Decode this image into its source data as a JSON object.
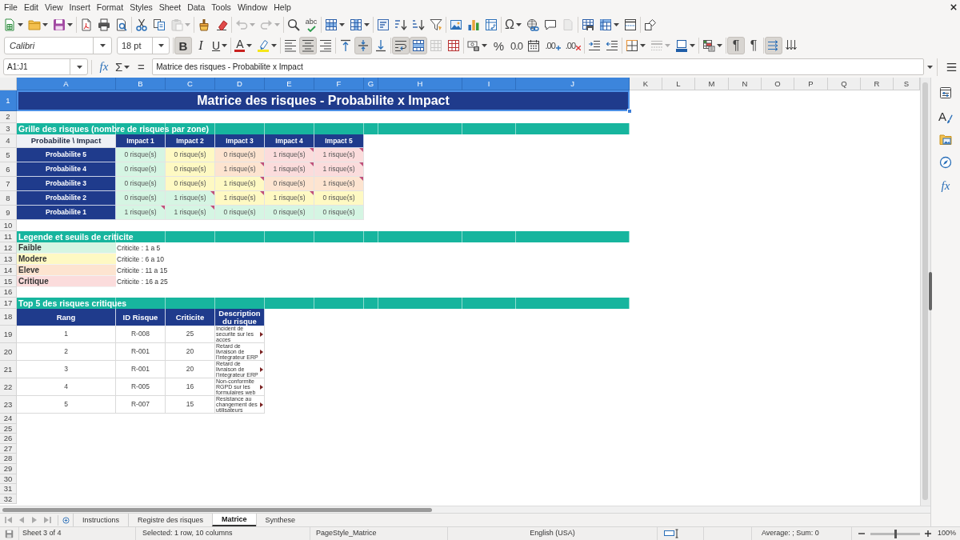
{
  "menu_bar": [
    "File",
    "Edit",
    "View",
    "Insert",
    "Format",
    "Styles",
    "Sheet",
    "Data",
    "Tools",
    "Window",
    "Help"
  ],
  "standard_toolbar": [
    [
      {
        "kind": "new",
        "disabled": false
      },
      {
        "kind": "open",
        "disabled": false
      },
      {
        "kind": "save",
        "disabled": false
      }
    ],
    [
      {
        "kind": "export_pdf",
        "disabled": false
      },
      {
        "kind": "print",
        "disabled": false
      },
      {
        "kind": "print_preview",
        "disabled": false
      }
    ],
    [
      {
        "kind": "cut",
        "disabled": false
      },
      {
        "kind": "copy",
        "disabled": false
      },
      {
        "kind": "paste",
        "disabled": true
      }
    ],
    [
      {
        "kind": "clone_formatting",
        "disabled": false
      },
      {
        "kind": "clear_formatting",
        "disabled": false
      }
    ],
    [
      {
        "kind": "undo",
        "disabled": true
      },
      {
        "kind": "redo",
        "disabled": true
      }
    ],
    [
      {
        "kind": "find_replace",
        "disabled": false
      },
      {
        "kind": "spelling",
        "glyph": "abc",
        "disabled": false
      }
    ],
    [
      {
        "kind": "row",
        "disabled": false
      },
      {
        "kind": "column",
        "disabled": false
      }
    ],
    [
      {
        "kind": "sort",
        "disabled": false
      },
      {
        "kind": "sort_ascending",
        "disabled": false
      },
      {
        "kind": "sort_descending",
        "disabled": false
      },
      {
        "kind": "autofilter",
        "disabled": false
      }
    ],
    [
      {
        "kind": "image",
        "disabled": false
      },
      {
        "kind": "chart",
        "disabled": false
      },
      {
        "kind": "pivot_table",
        "disabled": false
      }
    ],
    [
      {
        "kind": "special_character",
        "glyph": "Ω",
        "disabled": false
      },
      {
        "kind": "hyperlink",
        "disabled": false
      },
      {
        "kind": "comment",
        "disabled": false
      },
      {
        "kind": "header_footer",
        "disabled": true
      }
    ],
    [
      {
        "kind": "print_area",
        "disabled": false
      },
      {
        "kind": "freeze",
        "disabled": false
      },
      {
        "kind": "split_window",
        "disabled": false
      }
    ],
    [
      {
        "kind": "draw_functions",
        "disabled": false
      }
    ]
  ],
  "formatting_toolbar": {
    "font_name": "Calibri",
    "font_size": "18 pt",
    "groups": [
      [
        {
          "kind": "bold",
          "glyph": "B",
          "on": true,
          "disabled": false
        },
        {
          "kind": "italic",
          "glyph": "I",
          "on": false,
          "disabled": false
        },
        {
          "kind": "underline",
          "glyph": "U",
          "on": false,
          "disabled": false
        }
      ],
      [
        {
          "kind": "font_color",
          "glyph": "A",
          "on": false,
          "disabled": false
        },
        {
          "kind": "highlight",
          "on": false,
          "disabled": false
        }
      ],
      [
        {
          "kind": "align_left",
          "on": false,
          "disabled": false
        },
        {
          "kind": "align_center",
          "on": true,
          "disabled": false
        },
        {
          "kind": "align_right",
          "on": false,
          "disabled": false
        }
      ],
      [
        {
          "kind": "align_top",
          "on": false,
          "disabled": false
        },
        {
          "kind": "align_middle",
          "on": true,
          "disabled": false
        },
        {
          "kind": "align_bottom",
          "on": false,
          "disabled": false
        }
      ],
      [
        {
          "kind": "wrap_text",
          "on": true,
          "disabled": false
        },
        {
          "kind": "merge_center",
          "on": true,
          "disabled": false
        },
        {
          "kind": "merge_cells",
          "on": false,
          "disabled": true
        },
        {
          "kind": "unmerge_cells",
          "on": false,
          "disabled": false
        }
      ],
      [
        {
          "kind": "currency",
          "on": false,
          "disabled": false
        },
        {
          "kind": "percent",
          "glyph": "%",
          "on": false,
          "disabled": false
        },
        {
          "kind": "number",
          "glyph": "0.0",
          "on": false,
          "disabled": false
        },
        {
          "kind": "date",
          "on": false,
          "disabled": false
        },
        {
          "kind": "add_decimal",
          "glyph": ".00",
          "on": false,
          "disabled": false
        },
        {
          "kind": "delete_decimal",
          "glyph": ".00",
          "on": false,
          "disabled": false
        }
      ],
      [
        {
          "kind": "increase_indent",
          "on": false,
          "disabled": false
        },
        {
          "kind": "decrease_indent",
          "on": false,
          "disabled": false
        }
      ],
      [
        {
          "kind": "borders",
          "on": false,
          "disabled": false
        },
        {
          "kind": "border_style",
          "on": false,
          "disabled": true
        },
        {
          "kind": "border_color",
          "on": false,
          "disabled": false
        }
      ],
      [
        {
          "kind": "conditional",
          "on": false,
          "disabled": false
        }
      ],
      [
        {
          "kind": "left_to_right",
          "glyph": "¶",
          "on": true,
          "disabled": false
        },
        {
          "kind": "right_to_left",
          "glyph": "¶",
          "on": false,
          "disabled": false
        }
      ],
      [
        {
          "kind": "text_horizontal",
          "on": true,
          "disabled": false
        },
        {
          "kind": "text_vertical",
          "on": false,
          "disabled": false
        }
      ]
    ]
  },
  "formula_bar": {
    "name_box": "A1:J1",
    "buttons": [
      {
        "kind": "function_wizard",
        "glyph": "fx"
      },
      {
        "kind": "sum",
        "glyph": "Σ"
      },
      {
        "kind": "formula",
        "glyph": "="
      }
    ],
    "content": "Matrice des risques - Probabilite x Impact"
  },
  "sidebar": [
    {
      "kind": "properties"
    },
    {
      "kind": "styles",
      "glyph": "A"
    },
    {
      "kind": "gallery"
    },
    {
      "kind": "navigator"
    },
    {
      "kind": "functions",
      "glyph": "fx"
    }
  ],
  "sheet": {
    "columns": [
      {
        "label": "A",
        "selected": true
      },
      {
        "label": "B",
        "selected": true
      },
      {
        "label": "C",
        "selected": true
      },
      {
        "label": "D",
        "selected": true
      },
      {
        "label": "E",
        "selected": true
      },
      {
        "label": "F",
        "selected": true
      },
      {
        "label": "G",
        "selected": true
      },
      {
        "label": "H",
        "selected": true
      },
      {
        "label": "I",
        "selected": true
      },
      {
        "label": "J",
        "selected": true
      },
      {
        "label": "K",
        "selected": false
      },
      {
        "label": "L",
        "selected": false
      },
      {
        "label": "M",
        "selected": false
      },
      {
        "label": "N",
        "selected": false
      },
      {
        "label": "O",
        "selected": false
      },
      {
        "label": "P",
        "selected": false
      },
      {
        "label": "Q",
        "selected": false
      },
      {
        "label": "R",
        "selected": false
      },
      {
        "label": "S",
        "selected": false
      }
    ],
    "rows": [
      {
        "label": "1",
        "selected": true
      },
      {
        "label": "2",
        "selected": false
      },
      {
        "label": "3",
        "selected": false
      },
      {
        "label": "4",
        "selected": false
      },
      {
        "label": "5",
        "selected": false
      },
      {
        "label": "6",
        "selected": false
      },
      {
        "label": "7",
        "selected": false
      },
      {
        "label": "8",
        "selected": false
      },
      {
        "label": "9",
        "selected": false
      },
      {
        "label": "10",
        "selected": false
      },
      {
        "label": "11",
        "selected": false
      },
      {
        "label": "12",
        "selected": false
      },
      {
        "label": "13",
        "selected": false
      },
      {
        "label": "14",
        "selected": false
      },
      {
        "label": "15",
        "selected": false
      },
      {
        "label": "16",
        "selected": false
      },
      {
        "label": "17",
        "selected": false
      },
      {
        "label": "18",
        "selected": false
      },
      {
        "label": "19",
        "selected": false
      },
      {
        "label": "20",
        "selected": false
      },
      {
        "label": "21",
        "selected": false
      },
      {
        "label": "22",
        "selected": false
      },
      {
        "label": "23",
        "selected": false
      },
      {
        "label": "24",
        "selected": false
      },
      {
        "label": "25",
        "selected": false
      },
      {
        "label": "26",
        "selected": false
      },
      {
        "label": "27",
        "selected": false
      },
      {
        "label": "28",
        "selected": false
      },
      {
        "label": "29",
        "selected": false
      },
      {
        "label": "30",
        "selected": false
      },
      {
        "label": "31",
        "selected": false
      },
      {
        "label": "32",
        "selected": false
      }
    ],
    "title": {
      "text": "Matrice des risques - Probabilite x Impact",
      "selected": true
    },
    "risk_grid": {
      "title": "Grille des risques (nombre de risques par zone)",
      "corner": "Probabilite \\ Impact",
      "impacts": [
        "Impact 1",
        "Impact 2",
        "Impact 3",
        "Impact 4",
        "Impact 5"
      ],
      "rows": [
        {
          "label": "Probabilite 5",
          "cells": [
            {
              "text": "0 risque(s)",
              "color": "#d5f5e3",
              "comment": false
            },
            {
              "text": "0 risque(s)",
              "color": "#fef9c3",
              "comment": false
            },
            {
              "text": "0 risque(s)",
              "color": "#fde4d0",
              "comment": false
            },
            {
              "text": "1 risque(s)",
              "color": "#fbdcdc",
              "comment": true
            },
            {
              "text": "1 risque(s)",
              "color": "#fbdcdc",
              "comment": true
            }
          ]
        },
        {
          "label": "Probabilite 4",
          "cells": [
            {
              "text": "0 risque(s)",
              "color": "#d5f5e3",
              "comment": false
            },
            {
              "text": "0 risque(s)",
              "color": "#fef9c3",
              "comment": false
            },
            {
              "text": "1 risque(s)",
              "color": "#fde4d0",
              "comment": true
            },
            {
              "text": "1 risque(s)",
              "color": "#fbdcdc",
              "comment": true
            },
            {
              "text": "1 risque(s)",
              "color": "#fbdcdc",
              "comment": true
            }
          ]
        },
        {
          "label": "Probabilite 3",
          "cells": [
            {
              "text": "0 risque(s)",
              "color": "#d5f5e3",
              "comment": false
            },
            {
              "text": "0 risque(s)",
              "color": "#fef9c3",
              "comment": false
            },
            {
              "text": "1 risque(s)",
              "color": "#fef9c3",
              "comment": true
            },
            {
              "text": "0 risque(s)",
              "color": "#fde4d0",
              "comment": false
            },
            {
              "text": "1 risque(s)",
              "color": "#fde4d0",
              "comment": true
            }
          ]
        },
        {
          "label": "Probabilite 2",
          "cells": [
            {
              "text": "0 risque(s)",
              "color": "#d5f5e3",
              "comment": false
            },
            {
              "text": "1 risque(s)",
              "color": "#d5f5e3",
              "comment": true
            },
            {
              "text": "1 risque(s)",
              "color": "#fef9c3",
              "comment": true
            },
            {
              "text": "1 risque(s)",
              "color": "#fef9c3",
              "comment": true
            },
            {
              "text": "0 risque(s)",
              "color": "#fef9c3",
              "comment": false
            }
          ]
        },
        {
          "label": "Probabilite 1",
          "cells": [
            {
              "text": "1 risque(s)",
              "color": "#d5f5e3",
              "comment": true
            },
            {
              "text": "1 risque(s)",
              "color": "#d5f5e3",
              "comment": true
            },
            {
              "text": "0 risque(s)",
              "color": "#d5f5e3",
              "comment": false
            },
            {
              "text": "0 risque(s)",
              "color": "#d5f5e3",
              "comment": false
            },
            {
              "text": "0 risque(s)",
              "color": "#d5f5e3",
              "comment": false
            }
          ]
        }
      ]
    },
    "legend": {
      "title": "Legende et seuils de criticite",
      "items": [
        {
          "label": "Faible",
          "range": "Criticite : 1 a 5",
          "color": "#d5f5e3"
        },
        {
          "label": "Modere",
          "range": "Criticite : 6 a 10",
          "color": "#fef9c3"
        },
        {
          "label": "Eleve",
          "range": "Criticite : 11 a 15",
          "color": "#fde4d0"
        },
        {
          "label": "Critique",
          "range": "Criticite : 16 a 25",
          "color": "#fbdcdc"
        }
      ]
    },
    "top_risks": {
      "title": "Top 5 des risques critiques",
      "columns": [
        "Rang",
        "ID Risque",
        "Criticite",
        "Description du risque"
      ],
      "rows": [
        {
          "rank": "1",
          "id": "R-008",
          "score": "25",
          "description": "Incident de securite sur les acces",
          "clipped": true
        },
        {
          "rank": "2",
          "id": "R-001",
          "score": "20",
          "description": "Retard de livraison de l'integrateur ERP",
          "clipped": true
        },
        {
          "rank": "3",
          "id": "R-001",
          "score": "20",
          "description": "Retard de livraison de l'integrateur ERP",
          "clipped": true
        },
        {
          "rank": "4",
          "id": "R-005",
          "score": "16",
          "description": "Non-conformite RGPD sur les formulaires web",
          "clipped": true
        },
        {
          "rank": "5",
          "id": "R-007",
          "score": "15",
          "description": "Resistance au changement des utilisateurs",
          "clipped": true
        }
      ]
    }
  },
  "sheet_tabs": [
    {
      "label": "Instructions",
      "selected": false
    },
    {
      "label": "Registre des risques",
      "selected": false
    },
    {
      "label": "Matrice",
      "selected": true
    },
    {
      "label": "Synthese",
      "selected": false
    }
  ],
  "status_bar": {
    "sheet": "Sheet 3 of 4",
    "selection": "Selected: 1 row, 10 columns",
    "page_style": "PageStyle_Matrice",
    "language": "English (USA)",
    "summary": "Average: ; Sum: 0",
    "zoom": {
      "level": 0.5,
      "label": "100%"
    }
  }
}
